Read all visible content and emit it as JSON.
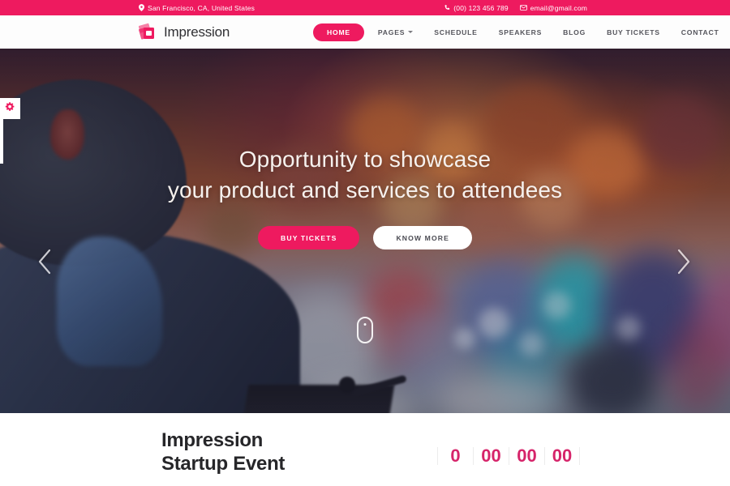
{
  "topbar": {
    "location_icon": "map-pin-icon",
    "location": "San Francisco, CA, United States",
    "phone_icon": "phone-icon",
    "phone": "(00) 123 456 789",
    "email_icon": "envelope-icon",
    "email": "email@gmail.com"
  },
  "brand": {
    "logo_icon": "ticket-stack-logo-icon",
    "name": "Impression"
  },
  "nav": {
    "items": [
      {
        "label": "HOME",
        "active": true,
        "has_caret": false
      },
      {
        "label": "PAGES",
        "active": false,
        "has_caret": true
      },
      {
        "label": "SCHEDULE",
        "active": false,
        "has_caret": false
      },
      {
        "label": "SPEAKERS",
        "active": false,
        "has_caret": false
      },
      {
        "label": "BLOG",
        "active": false,
        "has_caret": false
      },
      {
        "label": "BUY TICKETS",
        "active": false,
        "has_caret": false
      },
      {
        "label": "CONTACT",
        "active": false,
        "has_caret": false
      }
    ]
  },
  "hero": {
    "title_line1": "Opportunity to showcase",
    "title_line2": "your product and services to attendees",
    "primary_button": "BUY TICKETS",
    "secondary_button": "KNOW MORE",
    "prev_icon": "chevron-left-icon",
    "next_icon": "chevron-right-icon",
    "scroll_icon": "mouse-scroll-icon",
    "settings_icon": "gear-icon"
  },
  "event": {
    "title_line1": "Impression",
    "title_line2": "Startup Event",
    "countdown": [
      "0",
      "00",
      "00",
      "00"
    ]
  },
  "colors": {
    "accent": "#ee1a5f",
    "accent_dark": "#d6246a",
    "nav_text": "#55555c",
    "heading": "#262629",
    "topbar_text": "#ffffff"
  }
}
